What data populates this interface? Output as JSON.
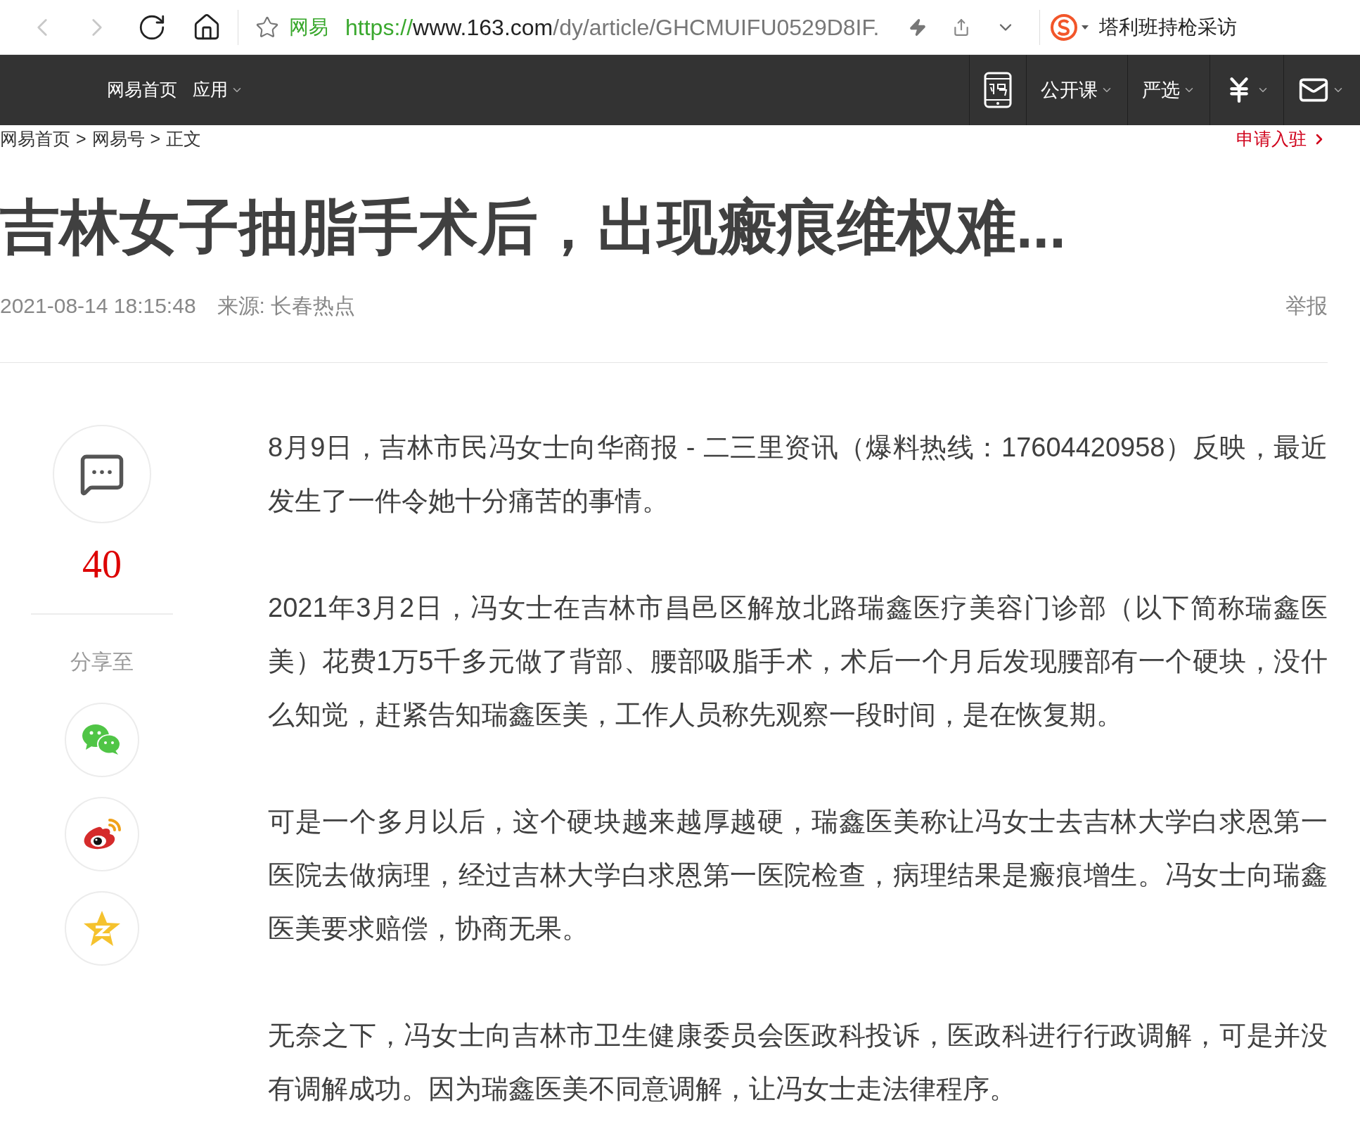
{
  "browser": {
    "buttons": [
      {
        "kind": "back",
        "disabled": true
      },
      {
        "kind": "forward",
        "disabled": true
      },
      {
        "kind": "reload",
        "disabled": false
      },
      {
        "kind": "home",
        "disabled": false
      }
    ],
    "address": {
      "site_label": "网易",
      "scheme": "https://",
      "host": "www.163.com",
      "path": "/dy/article/GHCMUIFU0529D8IF."
    },
    "search_text": "塔利班持枪采访"
  },
  "nav": {
    "left": [
      {
        "label": "网易首页",
        "dropdown": false
      },
      {
        "label": "应用",
        "dropdown": true
      }
    ],
    "right": [
      {
        "kind": "app",
        "dropdown": false
      },
      {
        "kind": "text",
        "label": "公开课",
        "dropdown": true
      },
      {
        "kind": "text",
        "label": "严选",
        "dropdown": true
      },
      {
        "kind": "yen",
        "dropdown": true
      },
      {
        "kind": "mail",
        "dropdown": true
      }
    ]
  },
  "breadcrumb": {
    "items": [
      "网易首页",
      "网易号",
      "正文"
    ],
    "separator": ">"
  },
  "apply_link": "申请入驻",
  "article": {
    "title": "吉林女子抽脂手术后，出现瘢痕维权难...",
    "time": "2021-08-14 18:15:48",
    "source": "来源: 长春热点",
    "report": "举报",
    "paragraphs": [
      "8月9日，吉林市民冯女士向华商报 - 二三里资讯（爆料热线：17604420958）反映，最近发生了一件令她十分痛苦的事情。",
      "2021年3月2日，冯女士在吉林市昌邑区解放北路瑞鑫医疗美容门诊部（以下简称瑞鑫医美）花费1万5千多元做了背部、腰部吸脂手术，术后一个月后发现腰部有一个硬块，没什么知觉，赶紧告知瑞鑫医美，工作人员称先观察一段时间，是在恢复期。",
      "可是一个多月以后，这个硬块越来越厚越硬，瑞鑫医美称让冯女士去吉林大学白求恩第一医院去做病理，经过吉林大学白求恩第一医院检查，病理结果是瘢痕增生。冯女士向瑞鑫医美要求赔偿，协商无果。",
      "无奈之下，冯女士向吉林市卫生健康委员会医政科投诉，医政科进行行政调解，可是并没有调解成功。因为瑞鑫医美不同意调解，让冯女士走法律程序。"
    ]
  },
  "sidebar": {
    "comment_count": "40",
    "share_label": "分享至",
    "share": [
      {
        "kind": "wechat"
      },
      {
        "kind": "weibo"
      },
      {
        "kind": "qzone"
      }
    ]
  }
}
